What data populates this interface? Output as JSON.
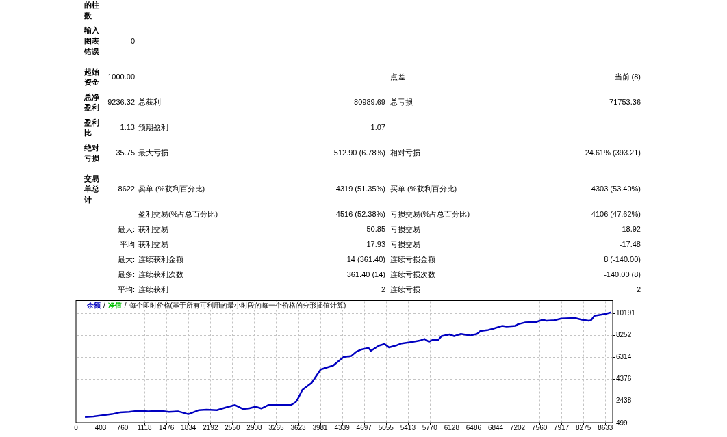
{
  "report": {
    "sections": [
      {
        "rows": [
          {
            "column_1": "的柱数"
          },
          {
            "column_1": "输入图表错误",
            "column_2": "0"
          }
        ]
      },
      {
        "rows": [
          {
            "column_1": "起始资金",
            "column_2": "1000.00",
            "column_5": "点差",
            "column_6": "当前 (8)"
          },
          {
            "column_1": "总净盈利",
            "column_2": "9236.32",
            "column_3": "总获利",
            "column_4": "80989.69",
            "column_5": "总亏损",
            "column_6": "-71753.36"
          },
          {
            "column_1": "盈利比",
            "column_2": "1.13",
            "column_3": "预期盈利",
            "column_4": "1.07"
          },
          {
            "column_1": "绝对亏损",
            "column_2": "35.75",
            "column_3": "最大亏损",
            "column_4": "512.90 (6.78%)",
            "column_5": "相对亏损",
            "column_6": "24.61% (393.21)"
          }
        ]
      },
      {
        "rows": [
          {
            "column_1": "交易单总计",
            "column_2": "8622",
            "column_3": "卖单 (%获利百分比)",
            "column_4": "4319 (51.35%)",
            "column_5": "买单 (%获利百分比)",
            "column_6": "4303 (53.40%)"
          },
          {
            "column_3": "盈利交易(%占总百分比)",
            "column_4": "4516 (52.38%)",
            "column_5": "亏损交易(%占总百分比)",
            "column_6": "4106 (47.62%)"
          },
          {
            "column_2": "最大:",
            "column_3": "获利交易",
            "column_4": "50.85",
            "column_5": "亏损交易",
            "column_6": "-18.92"
          },
          {
            "column_2": "平均",
            "column_3": "获利交易",
            "column_4": "17.93",
            "column_5": "亏损交易",
            "column_6": "-17.48"
          },
          {
            "column_2": "最大:",
            "column_3": "连续获利金额",
            "column_4": "14 (361.40)",
            "column_5": "连续亏损金额",
            "column_6": "8 (-140.00)"
          },
          {
            "column_2": "最多:",
            "column_3": "连续获利次数",
            "column_4": "361.40 (14)",
            "column_5": "连续亏损次数",
            "column_6": "-140.00 (8)"
          },
          {
            "column_2": "平均:",
            "column_3": "连续获利",
            "column_4": "2",
            "column_5": "连续亏损",
            "column_6": "2"
          }
        ]
      }
    ]
  },
  "chart": {
    "legend": [
      {
        "label": "净值",
        "color": "#00c000"
      }
    ],
    "legend_separators": [
      "/",
      "/"
    ],
    "chart_data": {
      "type": "line",
      "title": "每个即时价格(基于所有可利用的最小时段的每一个价格的分形插值计算)",
      "x": [
        146,
        287,
        437,
        585,
        715,
        864,
        1032,
        1181,
        1366,
        1516,
        1664,
        1832,
        1999,
        2130,
        2297,
        2446,
        2594,
        2725,
        2817,
        2929,
        3022,
        3135,
        3339,
        3506,
        3581,
        3618,
        3692,
        3841,
        3990,
        4195,
        4362,
        4492,
        4567,
        4642,
        4771,
        4809,
        4938,
        5032,
        5106,
        5236,
        5311,
        5497,
        5608,
        5683,
        5758,
        5831,
        5906,
        5962,
        6093,
        6167,
        6278,
        6427,
        6540,
        6596,
        6725,
        6800,
        6948,
        7023,
        7171,
        7209,
        7320,
        7506,
        7618,
        7673,
        7804,
        7915,
        8139,
        8251,
        8362,
        8400,
        8455,
        8622,
        8728
      ],
      "series": [
        {
          "name": "余额",
          "color": "#0000c0",
          "values": [
            1000,
            1050,
            1150,
            1250,
            1400,
            1450,
            1550,
            1500,
            1550,
            1450,
            1500,
            1250,
            1600,
            1650,
            1600,
            1850,
            2050,
            1700,
            1750,
            1900,
            1750,
            2050,
            2050,
            2050,
            2300,
            2600,
            3400,
            4000,
            5200,
            5550,
            6300,
            6400,
            6750,
            6950,
            7100,
            6850,
            7300,
            7450,
            7150,
            7350,
            7500,
            7650,
            7750,
            7900,
            7650,
            7850,
            7800,
            8150,
            8300,
            8150,
            8350,
            8200,
            8350,
            8600,
            8700,
            8800,
            9050,
            9000,
            9050,
            9200,
            9350,
            9400,
            9600,
            9500,
            9550,
            9700,
            9750,
            9600,
            9500,
            9550,
            9950,
            10100,
            10250
          ]
        }
      ],
      "xlim": [
        0,
        8753
      ],
      "ylim": [
        499,
        11292
      ],
      "grid": true,
      "xticks": [
        0,
        403,
        760,
        1118,
        1476,
        1834,
        2192,
        2550,
        2908,
        3265,
        3623,
        3981,
        4339,
        4697,
        5055,
        5413,
        5770,
        6128,
        6486,
        6844,
        7202,
        7560,
        7917,
        8275,
        8633
      ],
      "yticks": [
        499,
        2438,
        4376,
        6314,
        8252,
        10191
      ]
    }
  }
}
